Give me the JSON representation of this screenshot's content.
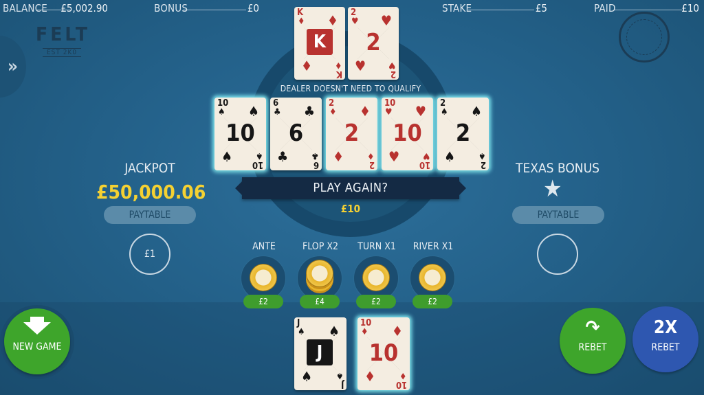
{
  "topbar": {
    "balance_label": "BALANCE",
    "balance_value": "£5,002.90",
    "bonus_label": "BONUS",
    "bonus_value": "£0",
    "stake_label": "STAKE",
    "stake_value": "£5",
    "paid_label": "PAID",
    "paid_value": "£10"
  },
  "logo": {
    "name": "FELT",
    "sub": "EST 2K0"
  },
  "menu_icon": "double-chevron-right-icon",
  "dealer_cards": [
    {
      "rank": "K",
      "suit": "♦",
      "color": "red"
    },
    {
      "rank": "2",
      "suit": "♥",
      "color": "red"
    }
  ],
  "dealer_note": "DEALER DOESN'T NEED TO QUALIFY",
  "community_cards": [
    {
      "rank": "10",
      "suit": "♠",
      "color": "black"
    },
    {
      "rank": "6",
      "suit": "♣",
      "color": "black"
    },
    {
      "rank": "2",
      "suit": "♦",
      "color": "red"
    },
    {
      "rank": "10",
      "suit": "♥",
      "color": "red"
    },
    {
      "rank": "2",
      "suit": "♠",
      "color": "black"
    }
  ],
  "banner": {
    "text": "PLAY AGAIN?",
    "amount": "£10"
  },
  "jackpot": {
    "title": "JACKPOT",
    "amount": "£50,000.06",
    "paytable": "PAYTABLE",
    "bet": "£1"
  },
  "texas_bonus": {
    "title": "TEXAS BONUS",
    "icon": "star-icon",
    "paytable": "PAYTABLE",
    "bet": ""
  },
  "bets": [
    {
      "label": "ANTE",
      "amount": "£2"
    },
    {
      "label": "FLOP X2",
      "amount": "£4"
    },
    {
      "label": "TURN X1",
      "amount": "£2"
    },
    {
      "label": "RIVER X1",
      "amount": "£2"
    }
  ],
  "player_cards": [
    {
      "rank": "J",
      "suit": "♠",
      "color": "black"
    },
    {
      "rank": "10",
      "suit": "♦",
      "color": "red"
    }
  ],
  "buttons": {
    "new_game": "NEW GAME",
    "rebet": "REBET",
    "double_rebet_top": "2X",
    "double_rebet_bottom": "REBET"
  },
  "colors": {
    "accent_yellow": "#f5d132",
    "green": "#3ea52b",
    "blue": "#2e57b0",
    "felt": "#24628b"
  }
}
